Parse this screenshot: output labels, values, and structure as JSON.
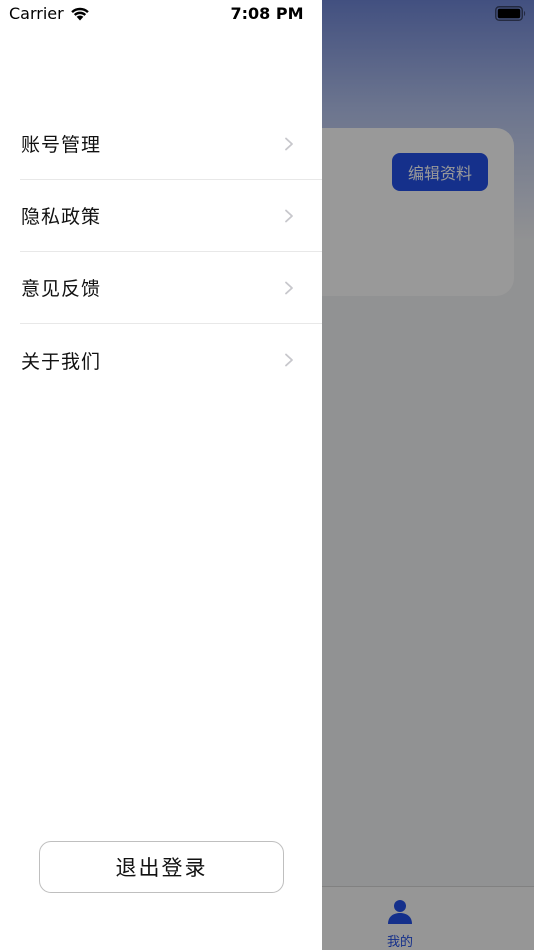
{
  "status_bar": {
    "carrier": "Carrier",
    "time": "7:08 PM",
    "wifi_icon": "wifi-icon",
    "battery_icon": "battery-icon"
  },
  "background": {
    "edit_profile_label": "编辑资料",
    "tab_bar": {
      "active_tab_label": "我的",
      "active_tab_icon": "person-icon"
    }
  },
  "drawer": {
    "menu_items": [
      {
        "label": "账号管理",
        "icon": "chevron-right-icon"
      },
      {
        "label": "隐私政策",
        "icon": "chevron-right-icon"
      },
      {
        "label": "意见反馈",
        "icon": "chevron-right-icon"
      },
      {
        "label": "关于我们",
        "icon": "chevron-right-icon"
      }
    ],
    "logout_label": "退出登录"
  },
  "colors": {
    "accent": "#2450e8",
    "header_gradient_top": "#6f86d6",
    "divider": "#e8e8e8"
  }
}
